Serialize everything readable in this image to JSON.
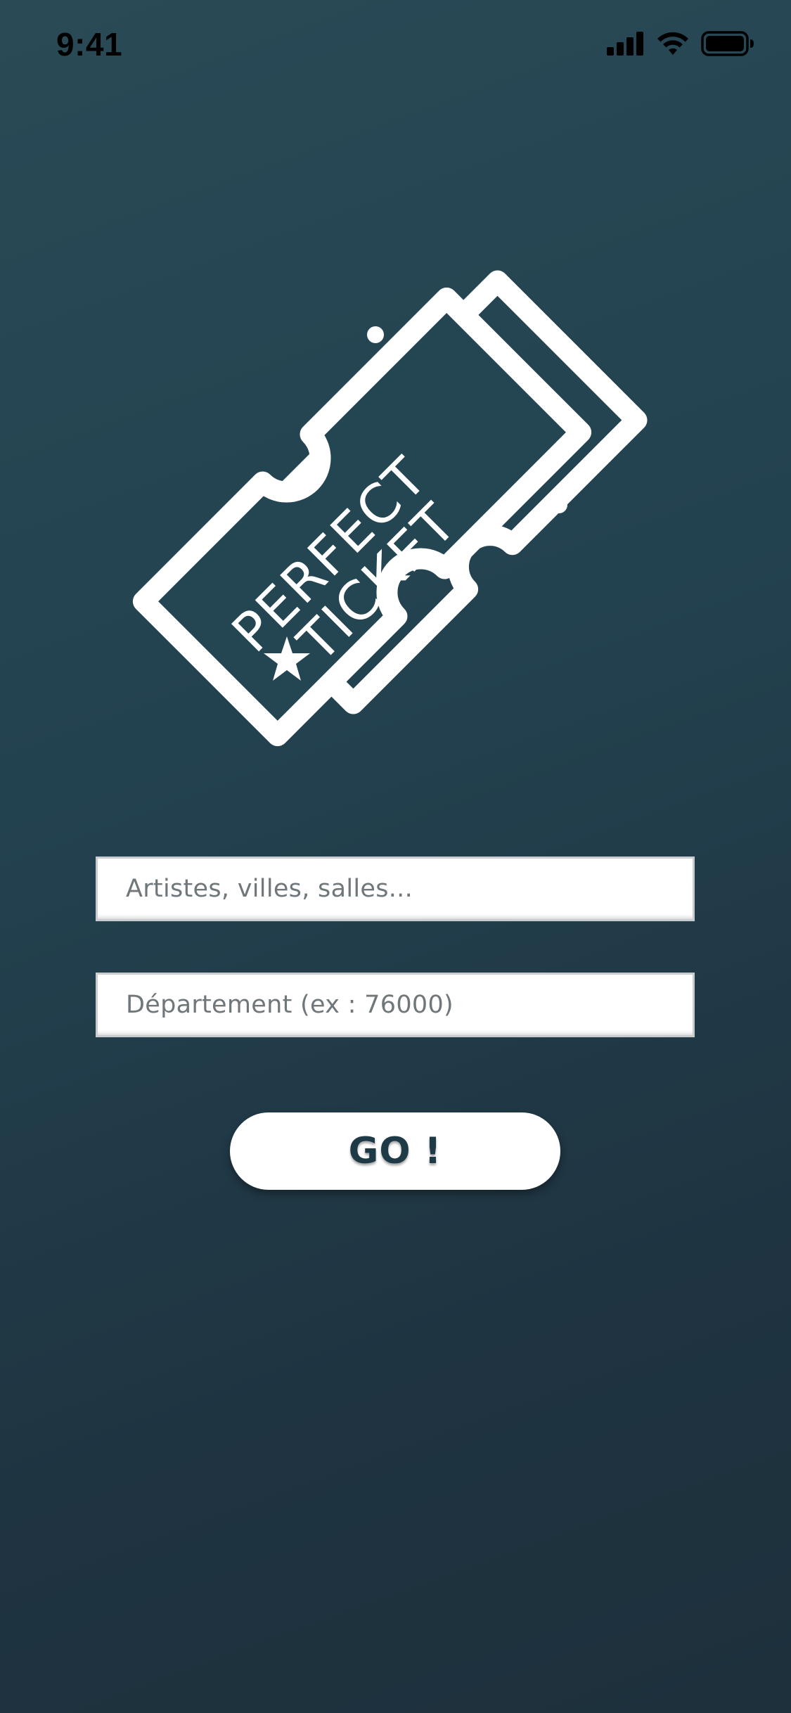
{
  "status_bar": {
    "time": "9:41",
    "icons": [
      "cellular-signal-icon",
      "wifi-icon",
      "battery-icon"
    ]
  },
  "logo": {
    "line1": "PERFECT",
    "line2": "TICKET",
    "icon": "ticket-star-icon"
  },
  "search": {
    "placeholder": "Artistes, villes, salles..."
  },
  "department": {
    "placeholder": "Département (ex : 76000)"
  },
  "go_button": {
    "label": "GO !"
  },
  "colors": {
    "background_top": "#2a4a56",
    "background_bottom": "#1d303c",
    "button_text": "#1f3a47",
    "placeholder_text": "#6f777b"
  }
}
